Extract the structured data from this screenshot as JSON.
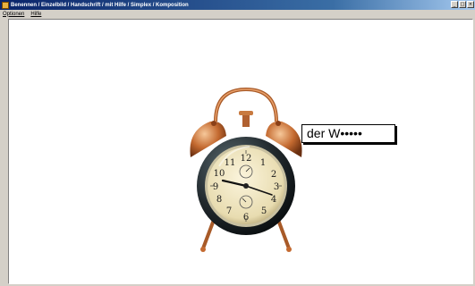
{
  "window": {
    "title": "Benennen / Einzelbild / Handschrift / mit Hilfe / Simplex / Komposition",
    "controls": [
      "_",
      "□",
      "×"
    ]
  },
  "menu": [
    {
      "label": "Optionen"
    },
    {
      "label": "Hilfe"
    }
  ],
  "content": {
    "image_icon": "alarm-clock",
    "word_hint": "der W•••••"
  }
}
